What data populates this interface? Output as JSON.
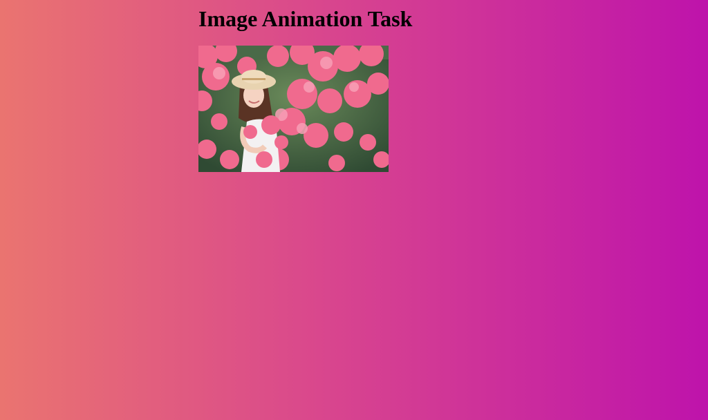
{
  "page": {
    "title": "Image Animation Task"
  },
  "image": {
    "subject": "woman-in-flower-bushes-photo",
    "colors": {
      "flowers": "#f06a8e",
      "foliage": "#3f6b40",
      "dress": "#f3f1f2"
    }
  },
  "background": {
    "gradient_start": "#ea7470",
    "gradient_end": "#be13ab"
  }
}
